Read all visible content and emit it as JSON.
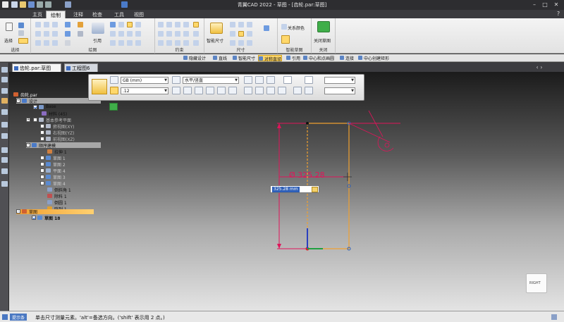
{
  "titlebar": {
    "title": "青翼CAD 2022 - 草图 - [齿轮.par:草图]"
  },
  "tabs": [
    "主页",
    "绘制",
    "注释",
    "检查",
    "工具",
    "视图"
  ],
  "active_tab": "绘制",
  "ribbon": {
    "groups": [
      "选择",
      "绘图",
      "约束",
      "尺寸",
      "智能草图",
      "关闭"
    ],
    "labels": {
      "select": "选择",
      "reference": "引用",
      "smart_dimension": "智能尺寸",
      "relation_color": "关系颜色",
      "close_sketch": "关闭草图"
    }
  },
  "command_bar": {
    "items": [
      "隐藏设计",
      "直线",
      "智能尺寸",
      "对称直径",
      "引用",
      "中心和点画圆",
      "连接",
      "中心创建矩形"
    ],
    "highlighted": "对称直径"
  },
  "doc_tabs": {
    "tab1": "齿轮.par:草图",
    "tab2": "工程图6"
  },
  "tree": {
    "root": "齿轮.par",
    "design": "设计",
    "base": "Base",
    "material": "材料 (45)",
    "base_ref_planes": "基本参考平面",
    "plane_xy": "俯视图(XY)",
    "plane_yz": "右视图(YZ)",
    "plane_xz": "前视图(XZ)",
    "features_header": "顺序建模",
    "f1": "拉伸 1",
    "f2": "草图 1",
    "f3": "草图 2",
    "f4": "平面 4",
    "f5": "草图 3",
    "f6": "草图 4",
    "f7": "倒斜角 1",
    "f8": "除料 1",
    "f9": "倒圆 1",
    "f10": "阵列 1",
    "sketch_header": "草图",
    "sketch_active": "草图 18"
  },
  "dim_toolbar": {
    "standard": "GB (mm)",
    "orientation": "水平/竖直",
    "precision": ".12"
  },
  "sketch": {
    "dimension_text": "Ø 325.28",
    "edit_value": "325.28 mm"
  },
  "viewcube": {
    "label": "RIGHT"
  },
  "status": {
    "label": "提示条",
    "prompt": "单击尺寸测量元素。'alt'=备选方向。('shift' 表示用 2 点。)"
  },
  "colors": {
    "accent": "#e0145a",
    "highlight": "#ffd86b",
    "select_blue": "#2e5fb8",
    "orange_line": "#f0a030"
  }
}
